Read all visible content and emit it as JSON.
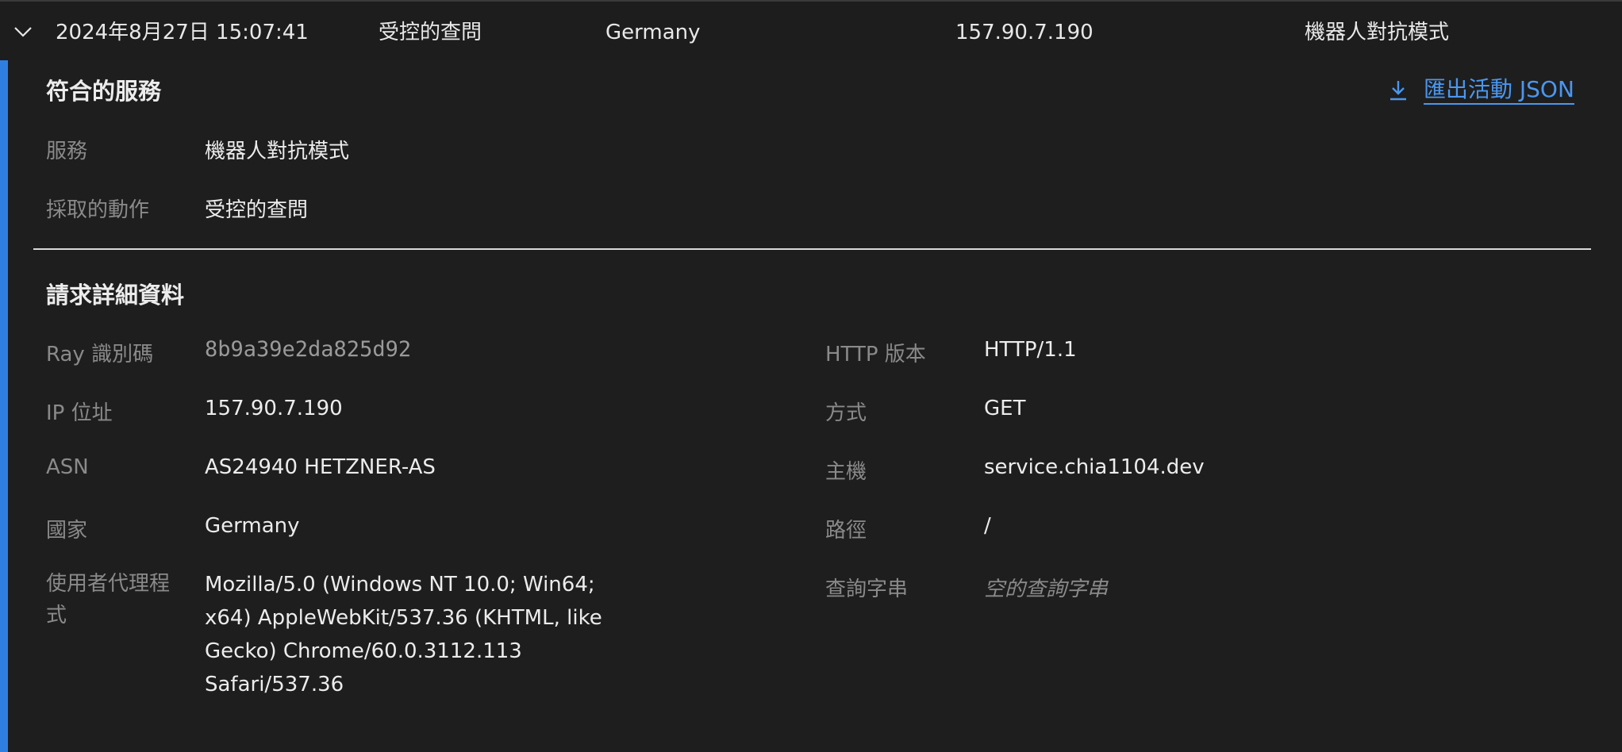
{
  "row": {
    "timestamp": "2024年8月27日 15:07:41",
    "action": "受控的查問",
    "country": "Germany",
    "ip": "157.90.7.190",
    "service": "機器人對抗模式"
  },
  "matched_service": {
    "title": "符合的服務",
    "export_label": "匯出活動 JSON",
    "service_label": "服務",
    "service_value": "機器人對抗模式",
    "action_label": "採取的動作",
    "action_value": "受控的查問"
  },
  "request_details": {
    "title": "請求詳細資料",
    "ray_id_label": "Ray 識別碼",
    "ray_id_value": "8b9a39e2da825d92",
    "ip_label": "IP 位址",
    "ip_value": "157.90.7.190",
    "asn_label": "ASN",
    "asn_value": "AS24940 HETZNER-AS",
    "country_label": "國家",
    "country_value": "Germany",
    "ua_label": "使用者代理程式",
    "ua_value": "Mozilla/5.0 (Windows NT 10.0; Win64; x64) AppleWebKit/537.36 (KHTML, like Gecko) Chrome/60.0.3112.113 Safari/537.36",
    "http_version_label": "HTTP 版本",
    "http_version_value": "HTTP/1.1",
    "method_label": "方式",
    "method_value": "GET",
    "host_label": "主機",
    "host_value": "service.chia1104.dev",
    "path_label": "路徑",
    "path_value": "/",
    "query_label": "查詢字串",
    "query_value": "空的查詢字串"
  },
  "icons": {
    "chevron": "chevron-down-icon",
    "download": "download-icon"
  },
  "colors": {
    "accent": "#2f7fe0",
    "link": "#4a97f0",
    "background": "#1b1b1b"
  }
}
